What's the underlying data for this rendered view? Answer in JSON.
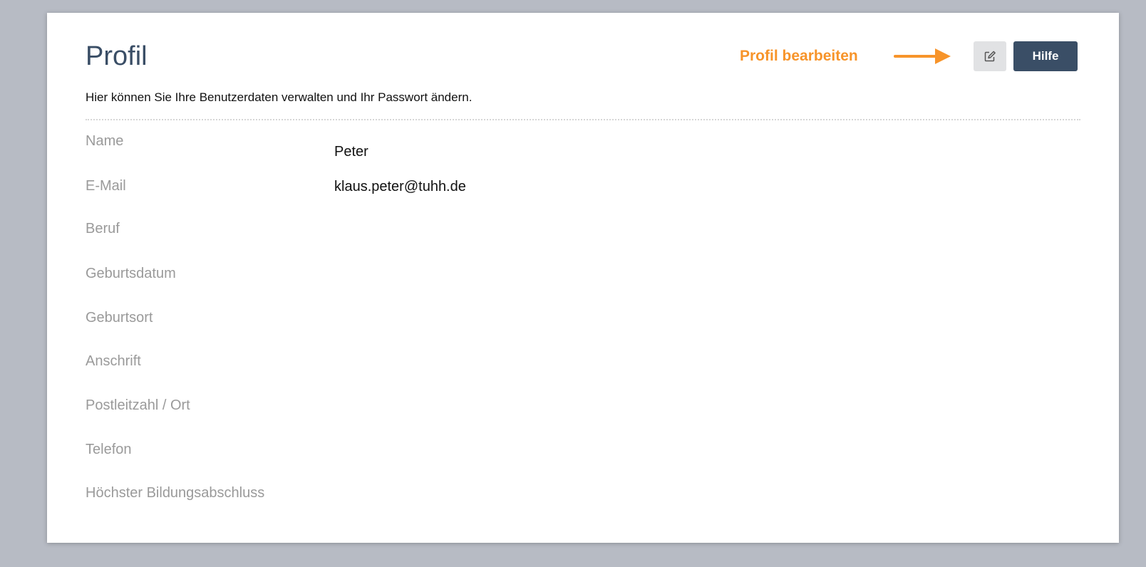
{
  "page": {
    "title": "Profil",
    "subtitle": "Hier können Sie Ihre Benutzerdaten verwalten und Ihr Passwort ändern."
  },
  "toolbar": {
    "annotation": "Profil bearbeiten",
    "edit_icon": "edit-icon",
    "help_label": "Hilfe"
  },
  "fields": {
    "name": {
      "label": "Name",
      "value": "Peter"
    },
    "email": {
      "label": "E-Mail",
      "value": "klaus.peter@tuhh.de"
    },
    "beruf": {
      "label": "Beruf",
      "value": ""
    },
    "geburtsdatum": {
      "label": "Geburtsdatum",
      "value": ""
    },
    "geburtsort": {
      "label": "Geburtsort",
      "value": ""
    },
    "anschrift": {
      "label": "Anschrift",
      "value": ""
    },
    "plz_ort": {
      "label": "Postleitzahl / Ort",
      "value": ""
    },
    "telefon": {
      "label": "Telefon",
      "value": ""
    },
    "bildungsabschluss": {
      "label": "Höchster Bildungsabschluss",
      "value": ""
    }
  },
  "colors": {
    "background": "#b7bbc4",
    "title": "#3a4e66",
    "accent": "#f7942a",
    "help_button": "#3a4e66",
    "label": "#9a9a9a"
  }
}
